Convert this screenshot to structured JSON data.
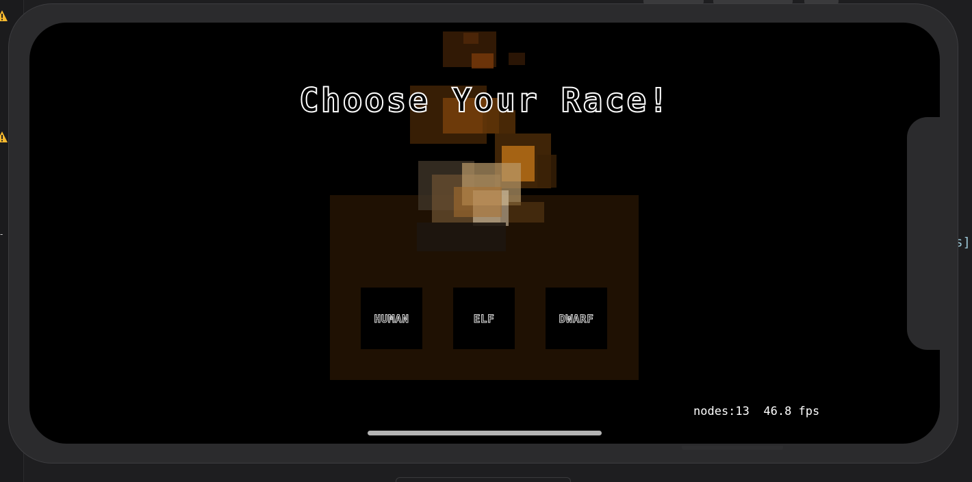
{
  "screen": {
    "title": "Choose Your Race!",
    "race_options": [
      {
        "label": "HUMAN"
      },
      {
        "label": "ELF"
      },
      {
        "label": "DWARF"
      }
    ],
    "debug": {
      "nodes_label": "nodes:13",
      "fps_label": "46.8 fps"
    }
  },
  "editor": {
    "right_code_fragment": "s]",
    "gutter_mark": "-"
  },
  "colors": {
    "panel": "#1f1103",
    "warning": "#f5b82e",
    "fire_orange": "#e08a1e"
  }
}
